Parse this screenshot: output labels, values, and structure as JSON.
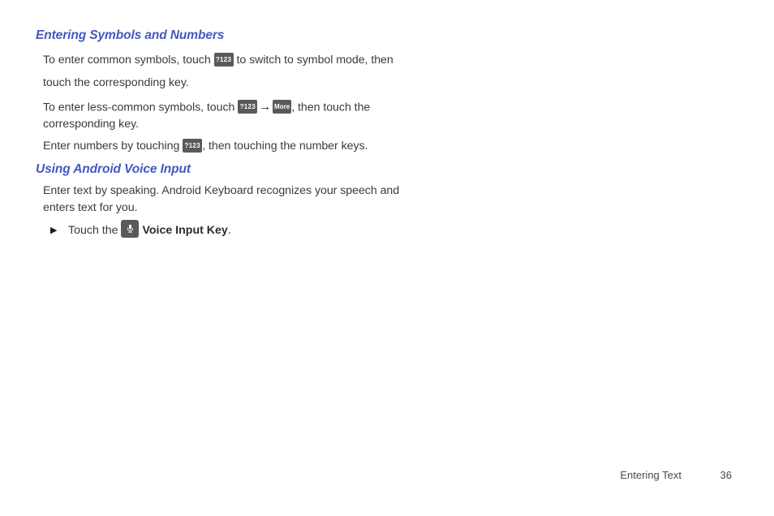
{
  "page": {
    "background_color": "#ffffff",
    "heading_color": "#4558bd",
    "body_text_color": "#3b3b3b",
    "key_chip_color": "#5a5a5a"
  },
  "sections": [
    {
      "heading": "Entering Symbols and Numbers",
      "paragraphs": [
        {
          "parts": [
            {
              "type": "text",
              "value": "To enter common symbols, touch "
            },
            {
              "type": "key",
              "value": "?123",
              "icon": "symbols-key"
            },
            {
              "type": "text",
              "value": " to switch to symbol mode, then touch the corresponding key."
            }
          ]
        },
        {
          "parts": [
            {
              "type": "text",
              "value": "To enter less-common symbols, touch "
            },
            {
              "type": "key",
              "value": "?123",
              "icon": "symbols-key"
            },
            {
              "type": "arrow",
              "value": "→",
              "icon": "right-arrow-icon"
            },
            {
              "type": "key",
              "value": "More",
              "icon": "more-key"
            },
            {
              "type": "text",
              "value": ", then touch the corresponding key."
            }
          ]
        },
        {
          "parts": [
            {
              "type": "text",
              "value": "Enter numbers by touching "
            },
            {
              "type": "key",
              "value": "?123",
              "icon": "symbols-key"
            },
            {
              "type": "text",
              "value": ", then touching the number keys."
            }
          ]
        }
      ]
    },
    {
      "heading": "Using Android Voice Input",
      "paragraphs": [
        {
          "parts": [
            {
              "type": "text",
              "value": "Enter text by speaking. Android Keyboard recognizes your speech and enters text for you."
            }
          ]
        }
      ],
      "bullet": {
        "marker": "▶",
        "marker_icon": "triangle-bullet-icon",
        "lead_text": "Touch the ",
        "key_icon": "microphone-key",
        "bold_term": "Voice Input Key",
        "trail_text": "."
      }
    }
  ],
  "paragraph_text": {
    "p1_before": "To enter common symbols, touch ",
    "p1_after": " to switch to symbol mode, then touch the corresponding key.",
    "p2_before": "To enter less-common symbols, touch ",
    "p2_after": ", then touch the corresponding key.",
    "p3_before": "Enter numbers by touching ",
    "p3_after": ", then touching the number keys.",
    "p4": "Enter text by speaking. Android Keyboard recognizes your speech and enters text for you."
  },
  "keys": {
    "symbols_label": "?123",
    "more_label": "More",
    "arrow": "→"
  },
  "bullet": {
    "marker": "▶",
    "lead": "Touch the",
    "bold_term": "Voice Input Key",
    "period": "."
  },
  "footer": {
    "label": "Entering Text",
    "page_number": "36"
  }
}
